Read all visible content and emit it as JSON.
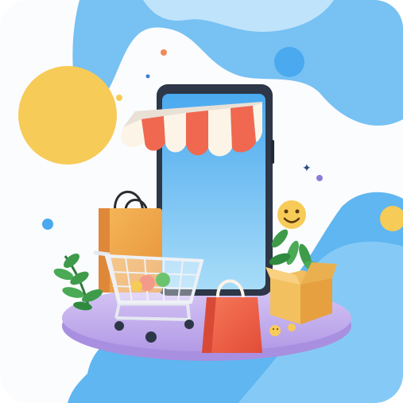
{
  "illustration": {
    "subject": "online-shopping-storefront-phone",
    "colors": {
      "blob_blue": "#5fb6f1",
      "blob_light": "#bfe3fb",
      "sun_yellow": "#f7cb57",
      "platform_purple": "#c9b6f0",
      "phone_frame": "#2d3748",
      "phone_screen": "#6cc3f4",
      "awning_red": "#f0684f",
      "awning_white": "#fdf4e8",
      "bag_orange": "#f3a84a",
      "bag_red": "#f0614a",
      "box_kraft": "#f1bd5a",
      "leaf_green": "#3e9b4a"
    }
  }
}
